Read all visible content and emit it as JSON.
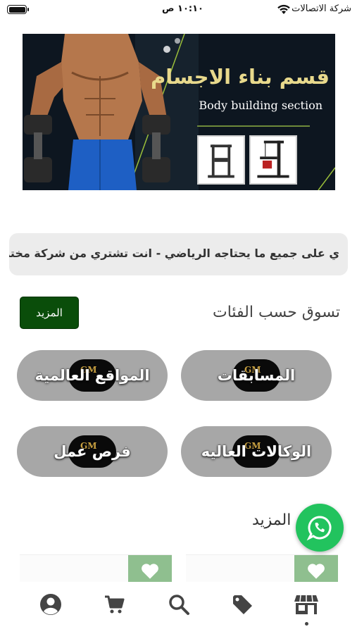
{
  "status_bar": {
    "carrier": "شركة الاتصالات",
    "time": "١٠:١٠ ص"
  },
  "banner": {
    "title_ar": "قسم بناء الاجسام",
    "title_en": "Body building section"
  },
  "marquee": {
    "text": "ي على جميع ما يحتاجه الرياضي -  انت تشتري من شركة مختص"
  },
  "categories_section": {
    "title": "تسوق حسب الفئات",
    "more_button": "المزيد",
    "items": [
      {
        "label": "المسابقات",
        "logo_text": "GM"
      },
      {
        "label": "المواقع العالمية",
        "logo_text": "GM"
      },
      {
        "label": "الوكالات العاليه",
        "logo_text": "GM"
      },
      {
        "label": "فرص عمل",
        "logo_text": "GM"
      }
    ]
  },
  "more_section": {
    "title": "المزيد"
  },
  "bottom_nav": {
    "items": [
      {
        "icon": "profile-icon"
      },
      {
        "icon": "cart-icon"
      },
      {
        "icon": "search-icon"
      },
      {
        "icon": "tag-icon"
      },
      {
        "icon": "store-icon",
        "active": true
      }
    ]
  },
  "colors": {
    "accent_green": "#0a4d0a",
    "whatsapp": "#22c35e",
    "pill_gray": "#a7a7a7",
    "banner_gold": "#e8d98c"
  }
}
